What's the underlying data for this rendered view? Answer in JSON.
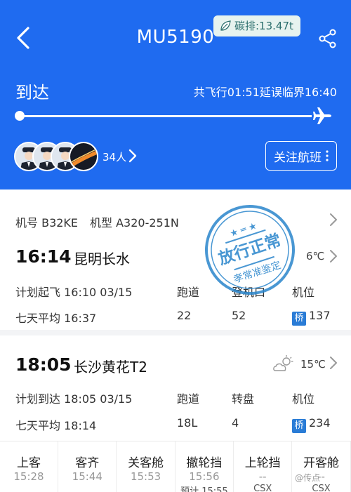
{
  "header": {
    "flight_no": "MU5190",
    "carbon": "碳排:13.47t",
    "status": "到达",
    "flight_info": "共飞行01:51延误临界16:40",
    "passenger_count": "34人",
    "follow_label": "关注航班",
    "progress": 1.0
  },
  "aircraft": {
    "reg": "机号 B32KE",
    "model": "机型 A320-251N"
  },
  "departure": {
    "time": "16:14",
    "city": "昆明长水",
    "temp": "6℃",
    "sched": "计划起飞 16:10 03/15",
    "avg": "七天平均 16:37",
    "col1_label": "跑道",
    "col1_value": "22",
    "col2_label": "登机口",
    "col2_value": "52",
    "col3_label": "机位",
    "bridge_tag": "桥",
    "col3_value": "137"
  },
  "arrival": {
    "time": "18:05",
    "city": "长沙黄花T2",
    "temp": "15℃",
    "sched": "计划到达 18:05 03/15",
    "avg": "七天平均 18:14",
    "col1_label": "跑道",
    "col1_value": "18L",
    "col2_label": "转盘",
    "col2_value": "4",
    "col3_label": "机位",
    "bridge_tag": "桥",
    "col3_value": "234"
  },
  "stamp": {
    "line1": "放行正常",
    "line2": "孝常准鉴定"
  },
  "timeline": [
    {
      "label": "上客",
      "value": "15:28",
      "sub": ""
    },
    {
      "label": "客齐",
      "value": "15:44",
      "sub": ""
    },
    {
      "label": "关客舱",
      "value": "15:53",
      "sub": ""
    },
    {
      "label": "撤轮挡",
      "value": "15:56",
      "sub": "预计 15:55"
    },
    {
      "label": "上轮挡",
      "value": "--",
      "sub": "CSX"
    },
    {
      "label": "开客舱",
      "value": "--",
      "sub": "CSX"
    }
  ],
  "watermark": "@传点",
  "colors": {
    "header_bg": "#1f6bf0",
    "bridge_tag": "#2a7cd6",
    "stamp": "#2a86cc"
  }
}
